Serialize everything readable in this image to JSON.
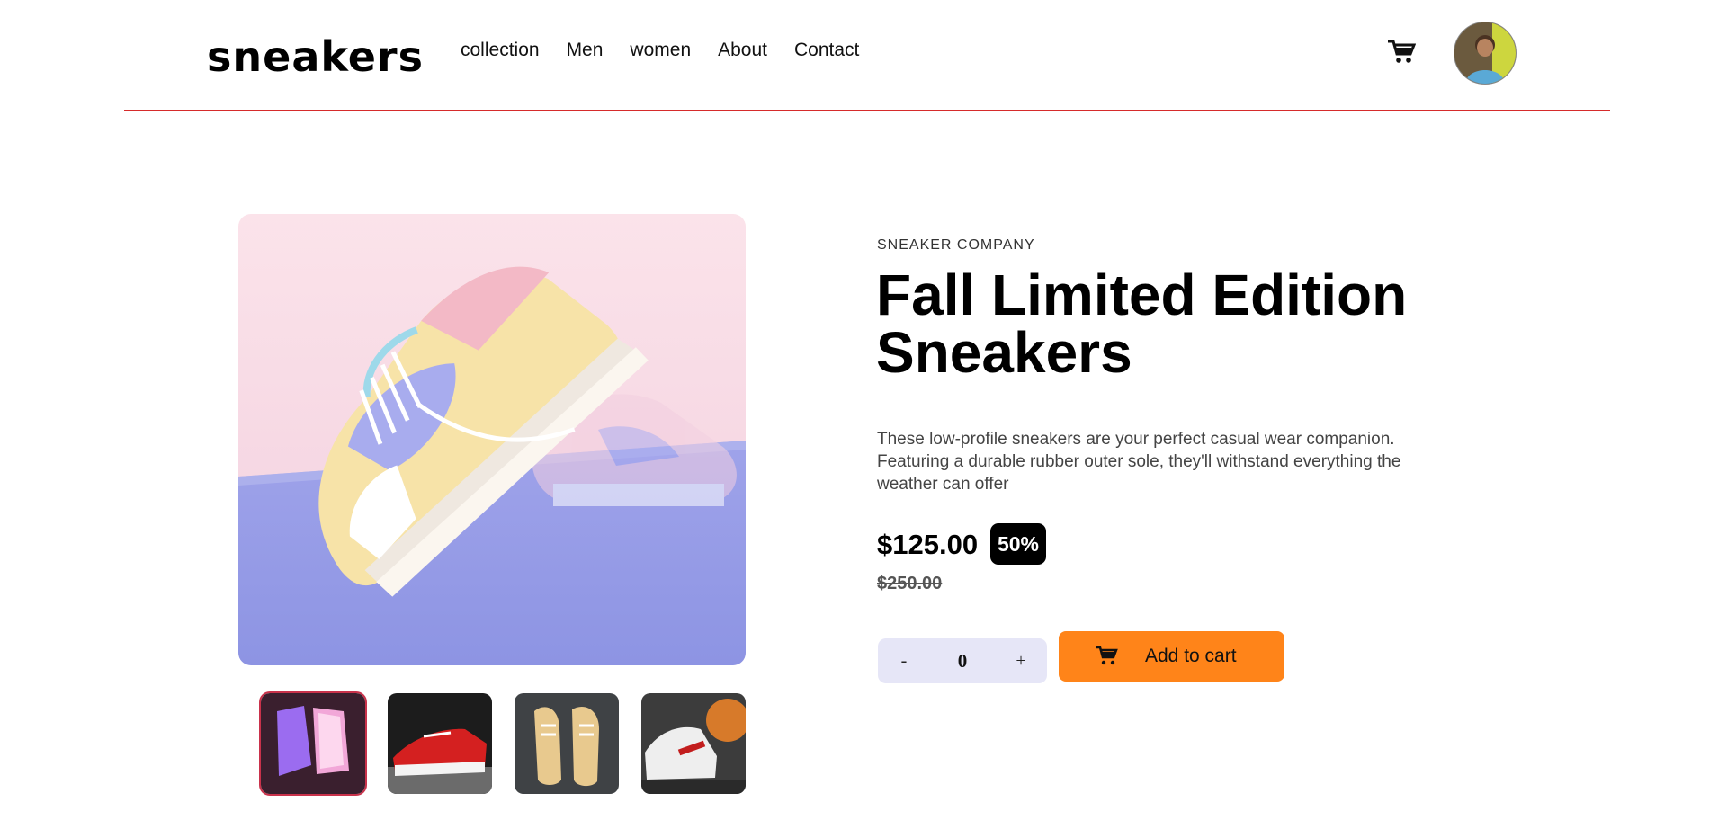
{
  "header": {
    "logo": "sneakers",
    "nav": [
      "collection",
      "Men",
      "women",
      "About",
      "Contact"
    ],
    "cart_icon": "cart-icon",
    "avatar_icon": "avatar-icon"
  },
  "product": {
    "company": "SNEAKER COMPANY",
    "title": "Fall Limited Edition Sneakers",
    "description": "These low-profile sneakers are your perfect casual wear companion. Featuring a durable rubber outer sole, they'll withstand everything the weather can offer",
    "price": "$125.00",
    "discount": "50%",
    "original_price": "$250.00"
  },
  "cart_controls": {
    "minus_label": "-",
    "quantity": "0",
    "plus_label": "+",
    "add_to_cart_label": "Add to cart"
  },
  "gallery": {
    "selected_index": 0,
    "thumbnails": [
      "pastel sneaker pair",
      "red canvas sneaker",
      "tan sneakers",
      "red white high-tops"
    ]
  },
  "colors": {
    "accent": "#ff8419",
    "divider": "#d62b2b",
    "quantity_bg": "#e6e6f7",
    "badge_bg": "#000000"
  }
}
